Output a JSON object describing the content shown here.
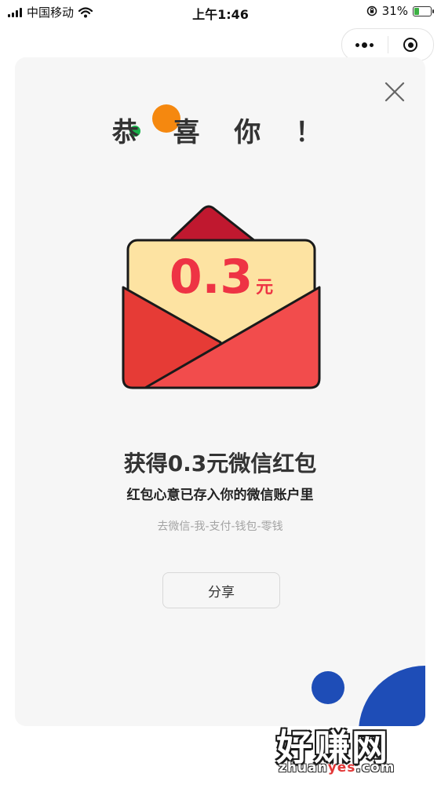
{
  "status_bar": {
    "carrier": "中国移动",
    "time": "上午1:46",
    "battery_percent": "31%",
    "icons": [
      "signal-icon",
      "wifi-icon",
      "orientation-lock-icon",
      "battery-charging-icon"
    ]
  },
  "capsule": {
    "icons": [
      "more-icon",
      "close-miniprogram-icon"
    ]
  },
  "card": {
    "title": "恭 喜 你 ！",
    "amount_value": "0.3",
    "amount_unit": "元",
    "main_text": "获得0.3元微信红包",
    "sub_text": "红包心意已存入你的微信账户里",
    "path_text": "去微信-我-支付-钱包-零钱",
    "share_label": "分享",
    "icons": [
      "close-icon",
      "red-envelope-icon"
    ]
  },
  "watermark": {
    "logo_text": "好赚网",
    "url_prefix": "zhuan",
    "url_highlight": "yes",
    "url_suffix": ".com"
  },
  "colors": {
    "card_bg": "#f6f6f6",
    "amount_red": "#ee3344",
    "green_dot": "#19b24a",
    "orange_dot": "#f5880f",
    "blue_decor": "#1e4db7"
  }
}
